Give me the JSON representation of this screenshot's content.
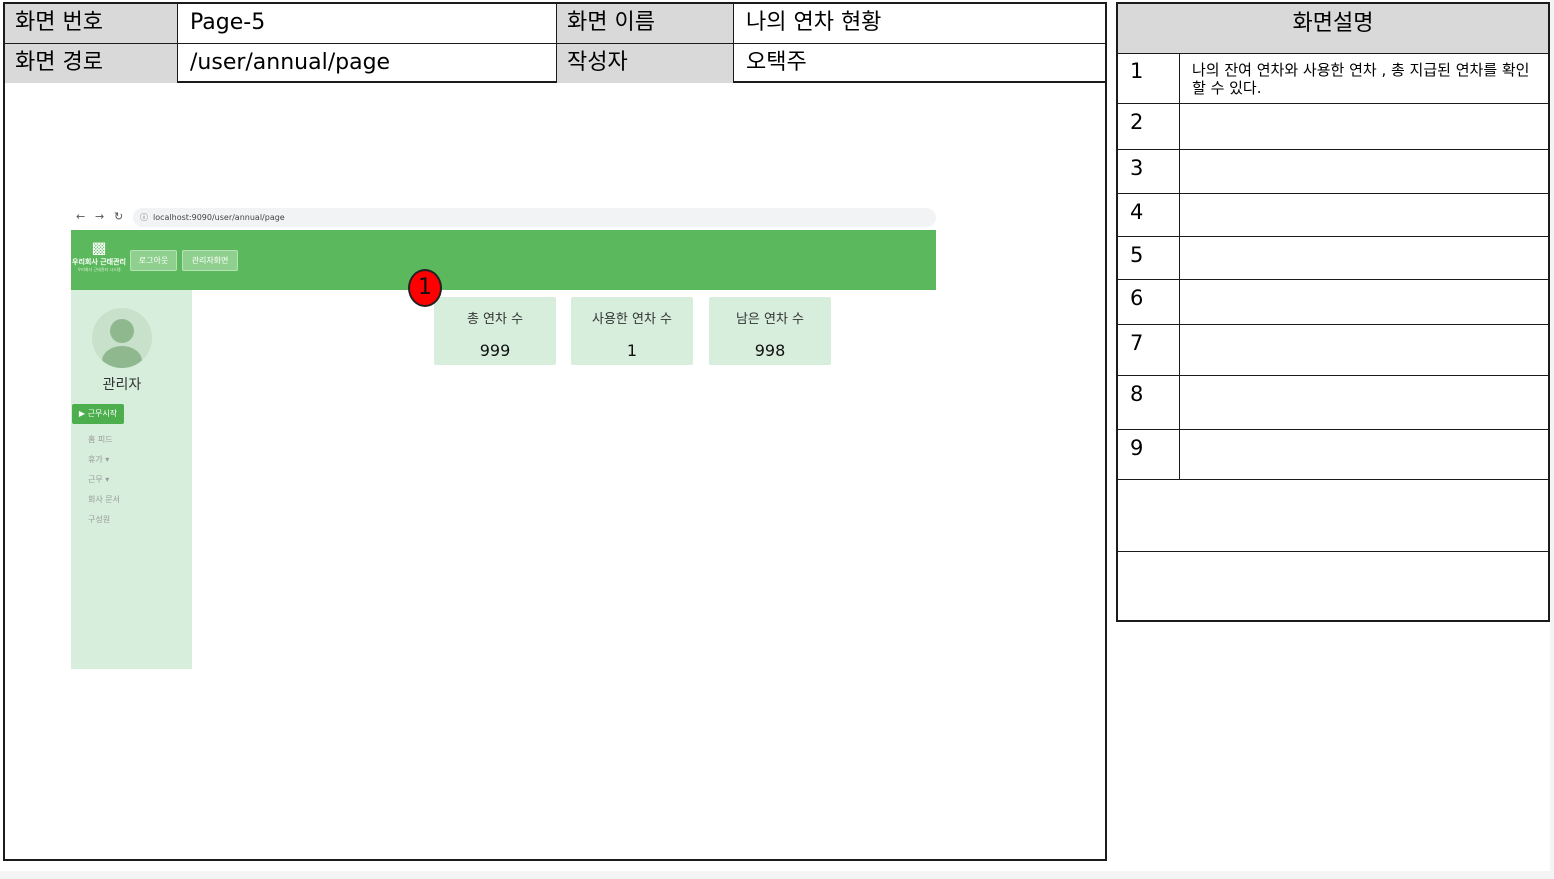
{
  "header": {
    "screen_no_label": "화면 번호",
    "screen_no": "Page-5",
    "screen_name_label": "화면 이름",
    "screen_name": "나의 연차 현황",
    "screen_path_label": "화면 경로",
    "screen_path": "/user/annual/page",
    "author_label": "작성자",
    "author": "오택주"
  },
  "description": {
    "title": "화면설명",
    "rows": [
      {
        "num": "1",
        "text": "나의 잔여 연차와 사용한 연차 , 총 지급된 연차를 확인할 수 있다."
      },
      {
        "num": "2",
        "text": ""
      },
      {
        "num": "3",
        "text": ""
      },
      {
        "num": "4",
        "text": ""
      },
      {
        "num": "5",
        "text": ""
      },
      {
        "num": "6",
        "text": ""
      },
      {
        "num": "7",
        "text": ""
      },
      {
        "num": "8",
        "text": ""
      },
      {
        "num": "9",
        "text": ""
      }
    ]
  },
  "screenshot": {
    "url": "localhost:9090/user/annual/page",
    "logo_text": "우리회사 근태관리",
    "logo_sub": "우리회사 근태관리 시스템",
    "logout_button": "로그아웃",
    "admin_button": "관리자화면",
    "user_name": "관리자",
    "start_work_button": "▶ 근무시작",
    "menu": [
      "홈 피드",
      "휴가 ▾",
      "근무 ▾",
      "회사 문서",
      "구성원"
    ],
    "cards": [
      {
        "title": "총 연차 수",
        "value": "999"
      },
      {
        "title": "사용한 연차 수",
        "value": "1"
      },
      {
        "title": "남은 연차 수",
        "value": "998"
      }
    ]
  },
  "marker": "1",
  "icons": {
    "back": "arrow-left-icon",
    "forward": "arrow-right-icon",
    "reload": "reload-icon",
    "info": "info-icon",
    "logo": "building-icon",
    "avatar": "user-avatar-icon"
  }
}
